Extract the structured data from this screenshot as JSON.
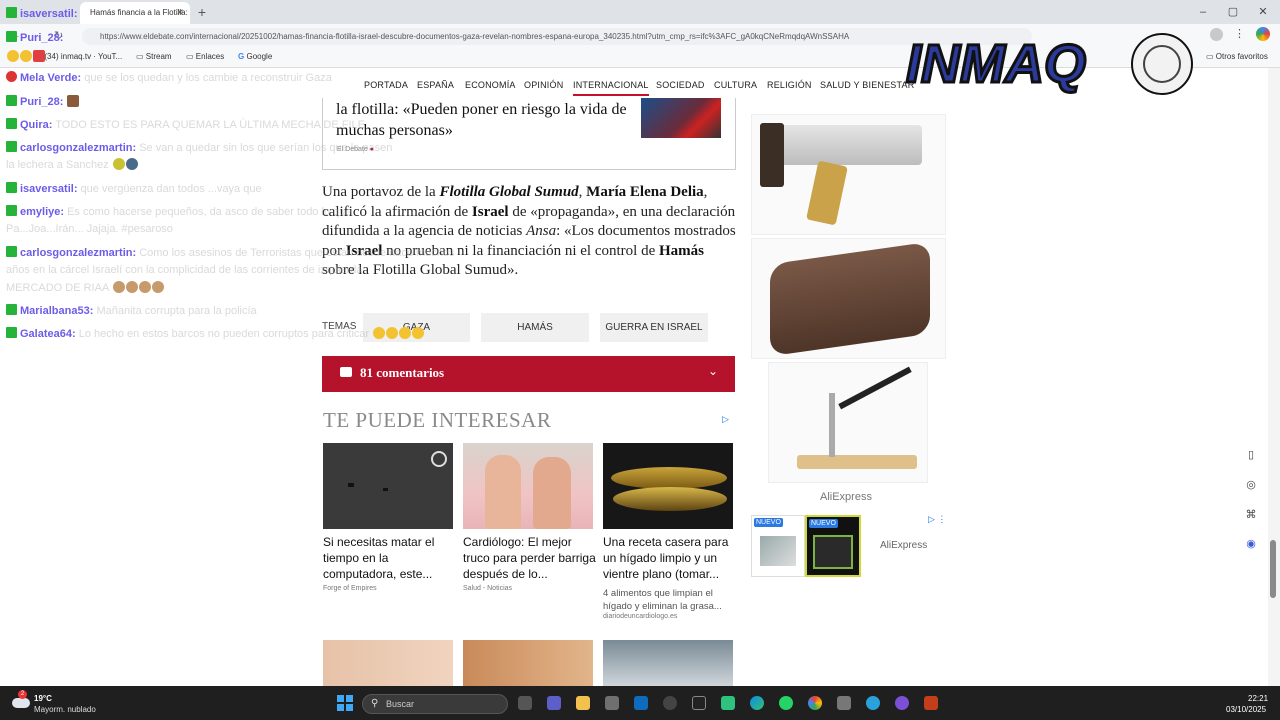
{
  "browser": {
    "tab_title": "Hamás financia a la Flotilla: Isr",
    "tab_close": "×",
    "new_tab": "+",
    "url": "https://www.eldebate.com/internacional/20251002/hamas-financia-flotilla-israel-descubre-documentos-gaza-revelan-nombres-espana-europa_340235.html?utm_cmp_rs=ifc%3AFC_gA0kqCNeRmqdqAWnSSAHA",
    "window_controls": [
      "–",
      "▢",
      "✕"
    ],
    "bookmarks": [
      "(34) inmaq.tv · YouT...",
      "Stream",
      "Enlaces",
      "Google"
    ],
    "other_bookmarks": "Otros favoritos"
  },
  "nav": {
    "items": [
      "PORTADA",
      "ESPAÑA",
      "ECONOMÍA",
      "OPINIÓN",
      "INTERNACIONAL",
      "SOCIEDAD",
      "CULTURA",
      "RELIGIÓN",
      "SALUD Y BIENESTAR"
    ]
  },
  "related": {
    "title": "la flotilla: «Pueden poner en riesgo la vida de muchas personas»",
    "source": "El Debate"
  },
  "article": {
    "p1": "Una portavoz de la ",
    "p2": "Flotilla Global Sumud",
    "p3": ", ",
    "p4": "María Elena Delia",
    "p5": ", calificó la afirmación de ",
    "p6": "Israel",
    "p7": " de «propaganda», en una declaración difundida a la agencia de noticias ",
    "p8": "Ansa",
    "p9": ": «Los documentos mostrados por ",
    "p10": "Israel",
    "p11": " no prueban ni la financiación ni el control de ",
    "p12": "Hamás",
    "p13": " sobre la Flotilla Global Sumud»."
  },
  "temas": {
    "label": "TEMAS",
    "tags": [
      "GAZA",
      "HAMÁS",
      "GUERRA EN ISRAEL"
    ]
  },
  "comments": {
    "label": "81 comentarios",
    "chevron": "⌄"
  },
  "recommend": {
    "heading": "TE PUEDE INTERESAR",
    "ad_mark": "▷",
    "cards": [
      {
        "title": "Si necesitas matar el tiempo en la computadora, este...",
        "source": "Forge of Empires"
      },
      {
        "title": "Cardiólogo: El mejor truco para perder barriga después de lo...",
        "source": "Salud - Noticias"
      },
      {
        "title": "Una receta casera para un hígado limpio y un vientre plano (tomar...",
        "desc": "4 alimentos que limpian el hígado y eliminan la grasa...",
        "source": "diariodeuncardiologo.es"
      }
    ]
  },
  "ads": {
    "choice_mark": "▷ ⋮",
    "aliexpress_1": "AliExpress",
    "aliexpress_2": "AliExpress",
    "new_badge": "NUEVO"
  },
  "logo": {
    "text": "INMAQ"
  },
  "chat": {
    "messages": [
      {
        "user": "isaversatil:",
        "text": "",
        "icon": "green"
      },
      {
        "user": "Puri_28:",
        "text": "",
        "icon": "green"
      },
      {
        "user": "",
        "text": "",
        "icon": "none"
      },
      {
        "user": "Mela Verde:",
        "text": "que se los quedan y los cambie a reconstruir Gaza",
        "icon": "red"
      },
      {
        "user": "Puri_28:",
        "text": "",
        "icon": "green"
      },
      {
        "user": "Quira:",
        "text": "TODO ESTO ES PARA QUEMAR LA ÚLTIMA MECHA DE FILE",
        "icon": "green"
      },
      {
        "user": "carlosgonzalezmartin:",
        "text": "Se van a quedar sin los que serían los que le pasen",
        "icon": "green"
      },
      {
        "user": "",
        "text": "la lechera a Sanchez",
        "icon": "none"
      },
      {
        "user": "isaversatil:",
        "text": "que vergüenza dan todos ...vaya que",
        "icon": "green"
      },
      {
        "user": "emyliye:",
        "text": "Es como hacerse pequeños, da asco de saber todo lo que",
        "icon": "green"
      },
      {
        "user": "",
        "text": "Pa...Joa...Irán... Jajaja. #pesaroso",
        "icon": "none"
      },
      {
        "user": "carlosgonzalezmartin:",
        "text": "Como los asesinos de Terroristas que están desde hace muchos",
        "icon": "green"
      },
      {
        "user": "",
        "text": "años en la cárcel Israelí con la complicidad de las corrientes de izquierda",
        "icon": "none"
      },
      {
        "user": "",
        "text": "MERCADO DE RIAA",
        "icon": "none"
      },
      {
        "user": "Marialbana53:",
        "text": "Mañanita corrupta para la policía",
        "icon": "green"
      },
      {
        "user": "Galatea64:",
        "text": "Lo hecho en estos barcos no pueden corruptos para criticar",
        "icon": "green"
      }
    ]
  },
  "taskbar": {
    "temp": "19°C",
    "weather": "Mayorm. nublado",
    "weather_badge": "2",
    "search_placeholder": "Buscar",
    "time": "22:21",
    "date": "03/10/2025"
  },
  "colors": {
    "accent_red": "#b5122c",
    "chat_user": "#6c5ce7",
    "chat_icon": "#25b33a"
  }
}
